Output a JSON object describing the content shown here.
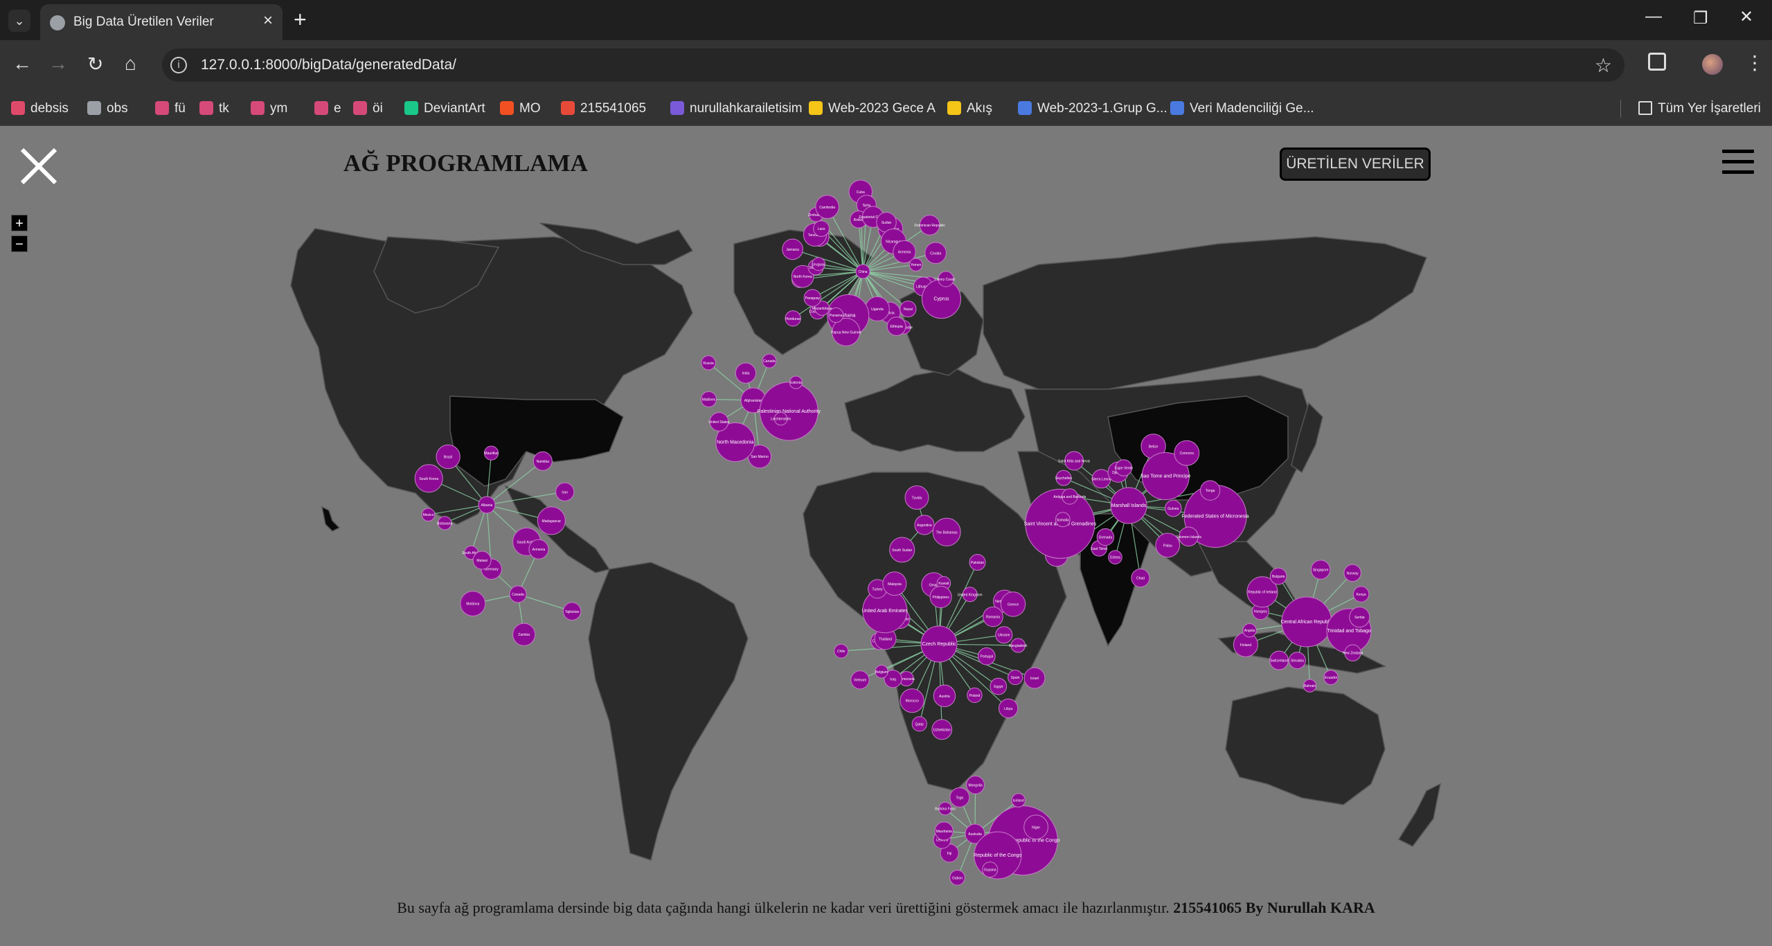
{
  "browser": {
    "tab_title": "Big Data Üretilen Veriler",
    "url": "127.0.0.1:8000/bigData/generatedData/",
    "bookmarks": [
      "debsis",
      "obs",
      "fü",
      "tk",
      "ym",
      "e",
      "öi",
      "DeviantArt",
      "MO",
      "215541065",
      "nurullahkarailetisim",
      "Web-2023 Gece A",
      "Akış",
      "Web-2023-1.Grup G...",
      "Veri Madenciliği Ge..."
    ],
    "all_bookmarks": "Tüm Yer İşaretleri"
  },
  "page": {
    "title": "AĞ PROGRAMLAMA",
    "data_button": "ÜRETİLEN VERİLER",
    "zoom_in": "+",
    "zoom_out": "−",
    "footer_text": "Bu sayfa ağ programlama dersinde big data çağında hangi ülkelerin ne kadar veri ürettiğini göstermek amacı ile hazırlanmıştır.",
    "footer_author": "215541065 By Nurullah KARA"
  },
  "colors": {
    "bubble": "#8e0c95",
    "bubble_stroke": "#c77bc9",
    "link": "#8fd6a8",
    "land": "#2b2b2b",
    "land_dark": "#0a0a0a",
    "ocean": "#7a7a7a"
  },
  "clusters": [
    {
      "hub": "China",
      "nodes": [
        "Sri Lanka",
        "Lithuania",
        "Cyprus",
        "Nepal",
        "El Salvador",
        "Latvia",
        "Ethiopia",
        "Uganda",
        "Myanmar",
        "Ghana",
        "Papua New Guinea",
        "Panama",
        "Costa Rica",
        "Mozambique",
        "Paraguay",
        "Honduras",
        "Georgia",
        "North Korea",
        "Slovenia",
        "Uruguay",
        "Jamaica",
        "Senegal",
        "Tanzania",
        "Laos",
        "Zimbabwe",
        "Cambodia",
        "Cuba",
        "Syria",
        "Bolivia",
        "Equatorial Guinea",
        "Kyrgyzstan",
        "Sudan",
        "Nicaragua",
        "Dominican Republic",
        "Armenia",
        "Yemen",
        "Croatia",
        "Ivory Coast"
      ]
    },
    {
      "hub": "Afghanistan",
      "nodes": [
        "Palestinian National Authority",
        "Liechtenstein",
        "San Marino",
        "North Macedonia",
        "United States",
        "Maldives",
        "Russia",
        "India",
        "Canada",
        "Estonia"
      ]
    },
    {
      "hub": "Albania",
      "nodes": [
        "Madagascar",
        "Saudi Arabia",
        "Germany",
        "South Africa",
        "Botswana",
        "Mexico",
        "South Korea",
        "Brazil",
        "Mauritius",
        "Namibia",
        "Iran"
      ]
    },
    {
      "hub": "Canada",
      "nodes": [
        "Tajikistan",
        "Zambia",
        "Moldova",
        "Malawi",
        "Armenia"
      ]
    },
    {
      "hub": "Argentina",
      "nodes": [
        "The Bahamas",
        "South Sudan",
        "Tuvalu"
      ]
    },
    {
      "hub": "Czech Republic",
      "nodes": [
        "Portugal",
        "Israel",
        "Spain",
        "Egypt",
        "Libya",
        "Poland",
        "Austria",
        "Uzbekistan",
        "Qatar",
        "Morocco",
        "Venezuela",
        "Iraq",
        "Belgium",
        "Vietnam",
        "Chile",
        "Colombia",
        "Thailand",
        "Kazakhstan",
        "United Arab Emirates",
        "Turkey",
        "Malaysia",
        "Oman",
        "Kuwait",
        "Philippines",
        "Pakistan",
        "United Kingdom",
        "Netherlands",
        "Romania",
        "Greece",
        "Ukraine",
        "Bangladesh"
      ]
    },
    {
      "hub": "Marshall Islands",
      "nodes": [
        "Federated States of Micronesia",
        "Solomon Islands",
        "Dominica",
        "Palau",
        "Chad",
        "Eritrea",
        "East Timor",
        "Grenada",
        "Rwanda",
        "Saint Vincent and the Grenadines",
        "Somalia",
        "Antigua and Barbuda",
        "Seychelles",
        "Saint Kitts and Nevis",
        "Sierra Leone",
        "Djibouti",
        "Cape Verde",
        "Belize",
        "Sao Tome and Principe",
        "Comoros",
        "Tonga",
        "Guinea"
      ]
    },
    {
      "hub": "Central African Republic",
      "nodes": [
        "Trinidad and Tobago",
        "New Zealand",
        "Ecuador",
        "Bahrain",
        "Slovakia",
        "Switzerland",
        "Finland",
        "Angola",
        "Hungary",
        "Republic of Ireland",
        "Bulgaria",
        "Singapore",
        "Norway",
        "Kenya",
        "Serbia"
      ]
    },
    {
      "hub": "Australia",
      "nodes": [
        "Democratic Republic of the Congo",
        "Republic of the Congo",
        "Guyana",
        "Gabon",
        "Fiji",
        "Lesotho",
        "Mauritania",
        "Burkina Faso",
        "Togo",
        "Mongolia",
        "Iceland",
        "Niger"
      ]
    }
  ]
}
